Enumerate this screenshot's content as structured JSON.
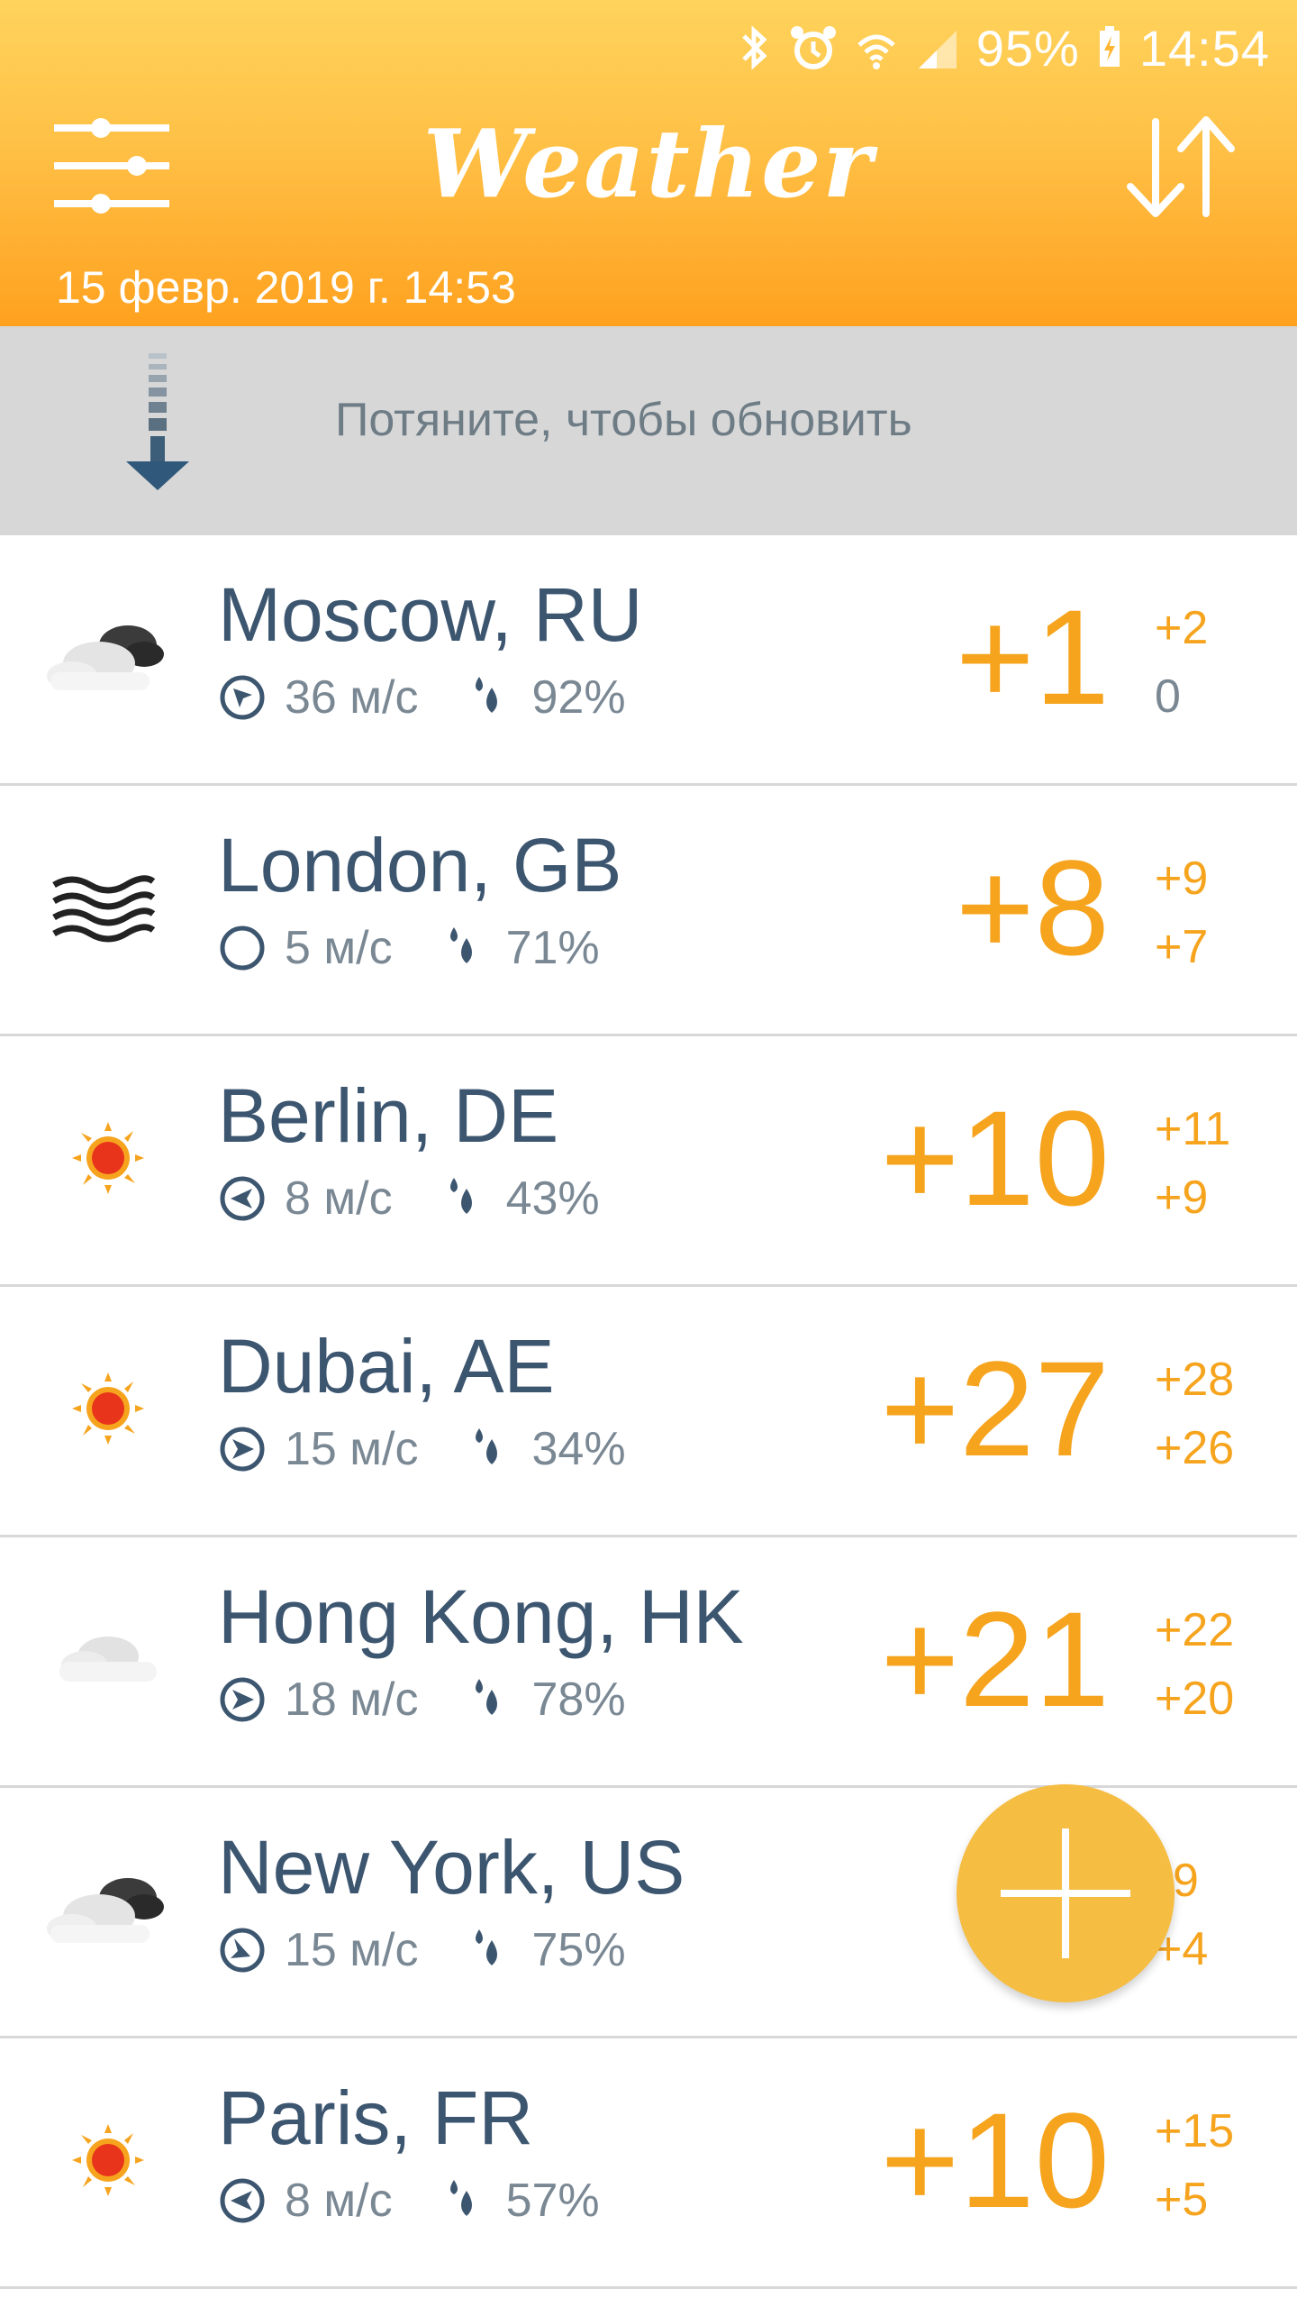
{
  "statusbar": {
    "battery": "95%",
    "time": "14:54"
  },
  "header": {
    "title": "Weather",
    "date": "15 февр. 2019 г. 14:53"
  },
  "refresh": {
    "text": "Потяните, чтобы обновить"
  },
  "colors": {
    "accent": "#F6A41E",
    "header_top": "#FFD35C",
    "header_bottom": "#FFA11F",
    "city": "#3D5670",
    "meta": "#7A8894"
  },
  "cities": [
    {
      "name": "Moscow, RU",
      "wind": "36 м/с",
      "humidity": "92%",
      "temp": "+1",
      "hi": "+2",
      "lo": "0",
      "icon": "partly-cloudy-icon"
    },
    {
      "name": "London, GB",
      "wind": "5 м/с",
      "humidity": "71%",
      "temp": "+8",
      "hi": "+9",
      "lo": "+7",
      "icon": "fog-icon"
    },
    {
      "name": "Berlin, DE",
      "wind": "8 м/с",
      "humidity": "43%",
      "temp": "+10",
      "hi": "+11",
      "lo": "+9",
      "icon": "sun-icon"
    },
    {
      "name": "Dubai, AE",
      "wind": "15 м/с",
      "humidity": "34%",
      "temp": "+27",
      "hi": "+28",
      "lo": "+26",
      "icon": "sun-icon"
    },
    {
      "name": "Hong Kong, HK",
      "wind": "18 м/с",
      "humidity": "78%",
      "temp": "+21",
      "hi": "+22",
      "lo": "+20",
      "icon": "cloud-icon"
    },
    {
      "name": "New York, US",
      "wind": "15 м/с",
      "humidity": "75%",
      "temp": "",
      "hi": "9",
      "lo": "+4",
      "icon": "partly-cloudy-icon"
    },
    {
      "name": "Paris, FR",
      "wind": "8 м/с",
      "humidity": "57%",
      "temp": "+10",
      "hi": "+15",
      "lo": "+5",
      "icon": "sun-icon"
    }
  ]
}
